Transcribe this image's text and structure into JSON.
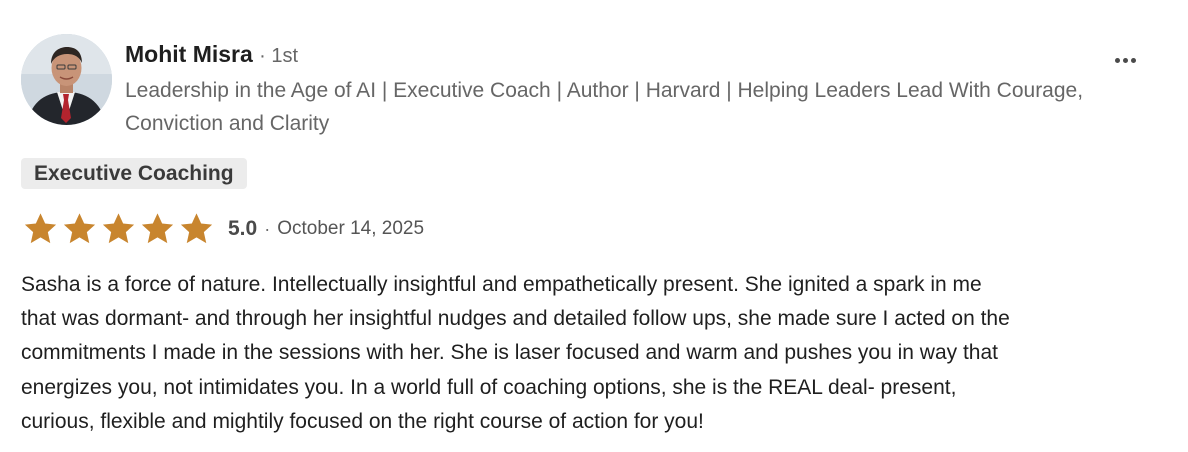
{
  "reviewer": {
    "name": "Mohit Misra",
    "degree": "· 1st",
    "headline": "Leadership in the Age of AI | Executive Coach | Author | Harvard | Helping Leaders Lead With Courage, Conviction and Clarity"
  },
  "menu": {
    "icon": "more-horizontal-icon"
  },
  "service_tag": "Executive Coaching",
  "rating": {
    "stars": 5,
    "max_stars": 5,
    "score": "5.0",
    "separator": "·",
    "date": "October 14, 2025",
    "star_color": "#c8852e"
  },
  "review_lines": [
    "Sasha is a force of nature. Intellectually insightful and empathetically present. She ignited a spark in me",
    "that was dormant- and through her insightful nudges and detailed follow ups, she made sure I acted on the",
    "commitments I made in the sessions with her. She is laser focused and warm and pushes you in way that",
    "energizes you, not intimidates you. In a world full of coaching options, she is the REAL deal- present,",
    "curious, flexible and mightily focused on the right course of action for you!"
  ]
}
